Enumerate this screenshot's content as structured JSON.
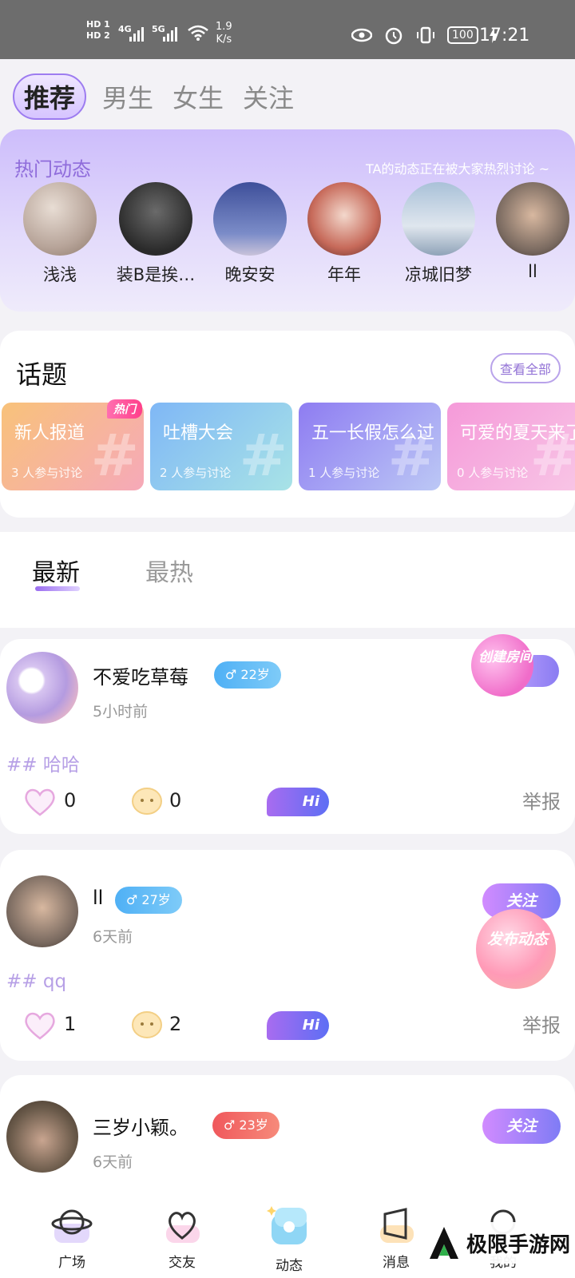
{
  "status_bar": {
    "hd1": "HD 1",
    "hd2": "HD 2",
    "net1": "4G",
    "net2": "5G",
    "speed_value": "1.9",
    "speed_unit": "K/s",
    "battery": "100",
    "time": "17:21"
  },
  "top_tabs": [
    "推荐",
    "男生",
    "女生",
    "关注"
  ],
  "hot_section": {
    "title": "热门动态",
    "subtitle": "TA的动态正在被大家热烈讨论 ~",
    "users": [
      {
        "name": "浅浅",
        "color": "#b8a59a"
      },
      {
        "name": "装B是挨…",
        "color": "#3a3a3a"
      },
      {
        "name": "晚安安",
        "color": "#5a6aa8"
      },
      {
        "name": "年年",
        "color": "#c77a6a"
      },
      {
        "name": "凉城旧梦",
        "color": "#8fa3b8"
      },
      {
        "name": "ll",
        "color": "#7a6a60"
      }
    ]
  },
  "topics": {
    "title": "话题",
    "see_all": "查看全部",
    "hot_badge": "热门",
    "items": [
      {
        "name": "新人报道",
        "count": "3 人参与讨论",
        "color1": "#f8c27a",
        "color2": "#f6a9b9"
      },
      {
        "name": "吐槽大会",
        "count": "2 人参与讨论",
        "color1": "#7fb7f6",
        "color2": "#9ee0e6"
      },
      {
        "name": "五一长假怎么过",
        "count": "1 人参与讨论",
        "color1": "#8e7cf2",
        "color2": "#b7c6f5"
      },
      {
        "name": "可爱的夏天来了",
        "count": "0 人参与讨论",
        "color1": "#f59ad9",
        "color2": "#f8c2e4"
      }
    ]
  },
  "feed_tabs": {
    "latest": "最新",
    "hottest": "最热"
  },
  "posts": [
    {
      "name": "不爱吃草莓",
      "age": "♂ 22岁",
      "age_color": "#5bb7f5",
      "time": "5小时前",
      "tag": "## 哈哈",
      "likes": "0",
      "comments": "0",
      "report": "举报",
      "hi": "Hi",
      "avatar_color": "#c8b2e8"
    },
    {
      "name": "ll",
      "age": "♂ 27岁",
      "age_color": "#5bb7f5",
      "time": "6天前",
      "tag": "## qq",
      "likes": "1",
      "comments": "2",
      "report": "举报",
      "hi": "Hi",
      "follow": "关注",
      "avatar_color": "#7a6a60"
    },
    {
      "name": "三岁小颖。",
      "age": "♂ 23岁",
      "age_color": "#f26b6b",
      "time": "6天前",
      "follow": "关注",
      "avatar_color": "#8a7a6a"
    }
  ],
  "floating": {
    "create_room": "创建房间",
    "publish": "发布动态"
  },
  "bottom_nav": [
    "广场",
    "交友",
    "动态",
    "消息",
    "我的"
  ],
  "watermark": "极限手游网"
}
